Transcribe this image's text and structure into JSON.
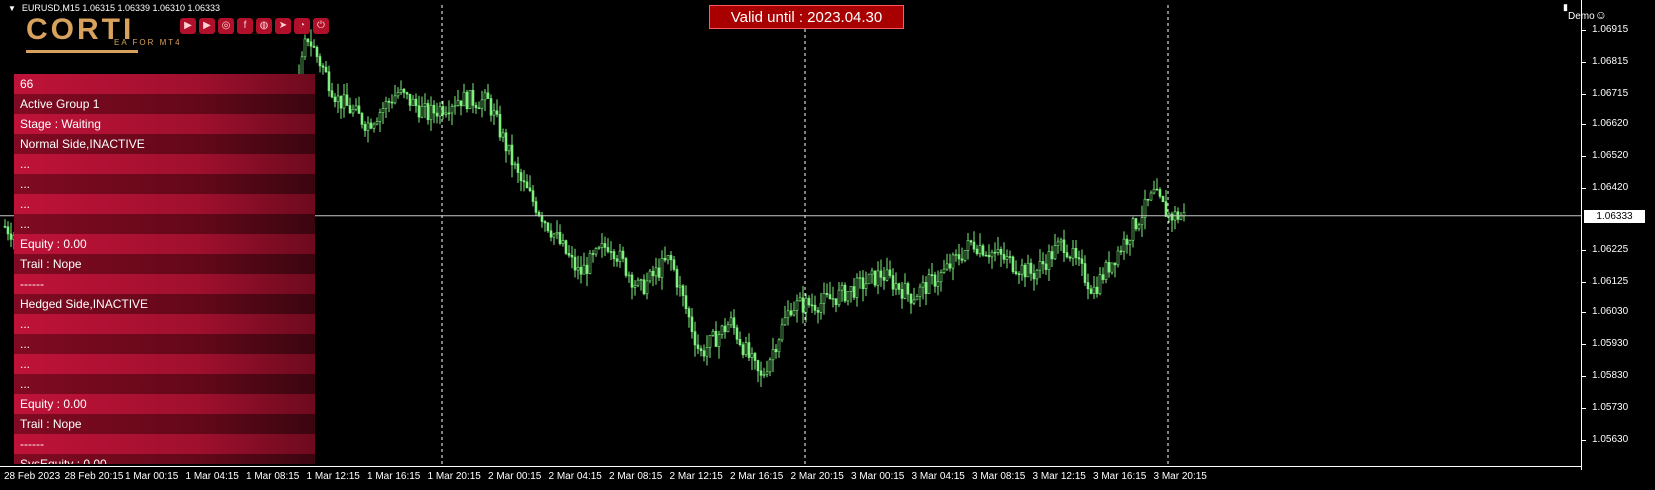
{
  "header": {
    "symbol_text": "EURUSD,M15  1.06315 1.06339 1.06310 1.06333",
    "account_label": "Demo",
    "collapse_icon": "triangle-down-icon",
    "demo_icon": "smiley-icon"
  },
  "banner": {
    "text": "Valid until : 2023.04.30"
  },
  "logo": {
    "title": "CORTI",
    "subtitle": "EA FOR MT4",
    "color": "#d8a15d"
  },
  "social_icons": [
    "youtube-icon",
    "youtube-icon",
    "instagram-icon",
    "facebook-icon",
    "globe-icon",
    "telegram-icon",
    "chart-icon",
    "power-icon"
  ],
  "panel": {
    "rows": [
      {
        "text": "66",
        "style": "a"
      },
      {
        "text": "Active Group 1",
        "style": "b"
      },
      {
        "text": "Stage : Waiting",
        "style": "a"
      },
      {
        "text": "Normal Side,INACTIVE",
        "style": "b"
      },
      {
        "text": "...",
        "style": "a"
      },
      {
        "text": "...",
        "style": "b"
      },
      {
        "text": "...",
        "style": "a"
      },
      {
        "text": "...",
        "style": "b"
      },
      {
        "text": "Equity : 0.00",
        "style": "a"
      },
      {
        "text": "Trail : Nope",
        "style": "b"
      },
      {
        "text": "------",
        "style": "a"
      },
      {
        "text": "Hedged Side,INACTIVE",
        "style": "b"
      },
      {
        "text": "...",
        "style": "a"
      },
      {
        "text": "...",
        "style": "b"
      },
      {
        "text": "...",
        "style": "a"
      },
      {
        "text": "...",
        "style": "b"
      },
      {
        "text": "Equity : 0.00",
        "style": "a"
      },
      {
        "text": "Trail : Nope",
        "style": "b"
      },
      {
        "text": "------",
        "style": "a"
      },
      {
        "text": "SysEquity : 0.00",
        "style": "b"
      }
    ]
  },
  "chart_data": {
    "type": "line",
    "price_labels": [
      "1.06915",
      "1.06815",
      "1.06715",
      "1.06620",
      "1.06520",
      "1.06420",
      "1.06225",
      "1.06125",
      "1.06030",
      "1.05930",
      "1.05830",
      "1.05730",
      "1.05630"
    ],
    "current_price": "1.06333",
    "time_labels": [
      "28 Feb 2023",
      "28 Feb 20:15",
      "1 Mar 00:15",
      "1 Mar 04:15",
      "1 Mar 08:15",
      "1 Mar 12:15",
      "1 Mar 16:15",
      "1 Mar 20:15",
      "2 Mar 00:15",
      "2 Mar 04:15",
      "2 Mar 08:15",
      "2 Mar 12:15",
      "2 Mar 16:15",
      "2 Mar 20:15",
      "3 Mar 00:15",
      "3 Mar 04:15",
      "3 Mar 08:15",
      "3 Mar 12:15",
      "3 Mar 16:15",
      "3 Mar 20:15"
    ],
    "ylim": [
      1.056,
      1.0696
    ],
    "x": [
      "28 Feb 2023",
      "28 Feb 20:15",
      "1 Mar 00:15",
      "1 Mar 04:15",
      "1 Mar 08:15",
      "1 Mar 10:15",
      "1 Mar 12:15",
      "1 Mar 14:15",
      "1 Mar 16:15",
      "1 Mar 18:15",
      "1 Mar 20:15",
      "1 Mar 22:15",
      "2 Mar 00:15",
      "2 Mar 02:15",
      "2 Mar 04:15",
      "2 Mar 06:15",
      "2 Mar 08:15",
      "2 Mar 10:15",
      "2 Mar 12:15",
      "2 Mar 14:15",
      "2 Mar 16:15",
      "2 Mar 18:15",
      "2 Mar 20:15",
      "2 Mar 22:15",
      "3 Mar 00:15",
      "3 Mar 02:15",
      "3 Mar 04:15",
      "3 Mar 06:15",
      "3 Mar 08:15",
      "3 Mar 10:15",
      "3 Mar 12:15",
      "3 Mar 14:15",
      "3 Mar 16:15",
      "3 Mar 18:15",
      "3 Mar 20:15",
      "3 Mar 21:15"
    ],
    "series": [
      {
        "values": [
          1.063,
          1.0615,
          1.0595,
          1.059,
          1.0615,
          1.0635,
          1.069,
          1.067,
          1.0662,
          1.0672,
          1.0665,
          1.067,
          1.0669,
          1.0645,
          1.063,
          1.0615,
          1.0625,
          1.061,
          1.062,
          1.059,
          1.06,
          1.0582,
          1.0605,
          1.0606,
          1.061,
          1.0615,
          1.0608,
          1.0615,
          1.0625,
          1.062,
          1.0615,
          1.0625,
          1.061,
          1.0625,
          1.064,
          1.06333
        ]
      }
    ],
    "vlines": [
      "1 Mar 20:15",
      "2 Mar 20:15",
      "3 Mar 20:15"
    ],
    "bar_color": "#7ef07e"
  }
}
